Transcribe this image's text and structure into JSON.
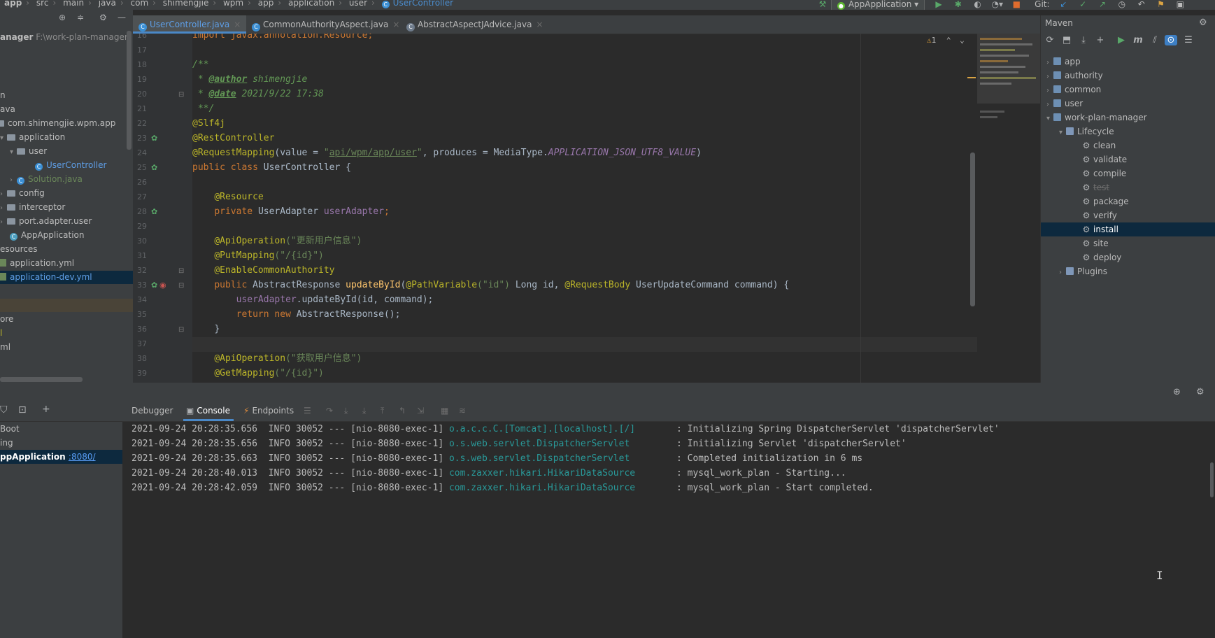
{
  "breadcrumb": [
    "app",
    "src",
    "main",
    "java",
    "com",
    "shimengjie",
    "wpm",
    "app",
    "application",
    "user",
    "UserController"
  ],
  "run_config": "AppApplication",
  "vcs_label": "Git:",
  "project": {
    "root_name": "anager",
    "root_path": "F:\\work-plan-manager",
    "rows": [
      {
        "label": "n"
      },
      {
        "label": "ava"
      },
      {
        "label": "com.shimengjie.wpm.app"
      },
      {
        "label": "application"
      },
      {
        "label": "user"
      },
      {
        "label": "UserController"
      },
      {
        "label": "Solution.java"
      },
      {
        "label": "config"
      },
      {
        "label": "interceptor"
      },
      {
        "label": "port.adapter.user"
      },
      {
        "label": "AppApplication"
      },
      {
        "label": "esources"
      },
      {
        "label": "application.yml"
      },
      {
        "label": "application-dev.yml"
      },
      {
        "label": ""
      },
      {
        "label": "ore"
      },
      {
        "label": "l"
      },
      {
        "label": "ml"
      }
    ]
  },
  "tabs": [
    {
      "label": "UserController.java"
    },
    {
      "label": "CommonAuthorityAspect.java"
    },
    {
      "label": "AbstractAspectJAdvice.java"
    }
  ],
  "editor": {
    "warnings": "1",
    "line_numbers": [
      "16",
      "17",
      "18",
      "19",
      "20",
      "21",
      "22",
      "23",
      "24",
      "25",
      "26",
      "27",
      "28",
      "29",
      "30",
      "31",
      "32",
      "33",
      "34",
      "35",
      "36",
      "37",
      "38",
      "39"
    ],
    "code": {
      "l16": "import javax.annotation.Resource;",
      "l18": "/**",
      "l19_tag": "@author",
      "l19_val": " shimengjie",
      "l20_tag": "@date",
      "l20_val": " 2021/9/22 17:38",
      "l21": " **/",
      "l22": "@Slf4j",
      "l23": "@RestController",
      "l24_ann": "@RequestMapping",
      "l24_a": "(value = ",
      "l24_q1": "\"",
      "l24_path": "api/wpm/app/user",
      "l24_q2": "\"",
      "l24_b": ", produces = MediaType.",
      "l24_const": "APPLICATION_JSON_UTF8_VALUE",
      "l24_c": ")",
      "l25_kw": "public class ",
      "l25_name": "UserController {",
      "l27": "@Resource",
      "l28_kw": "private ",
      "l28_type": "UserAdapter ",
      "l28_field": "userAdapter",
      "l28_end": ";",
      "l30_ann": "@ApiOperation",
      "l30_str": "(\"更新用户信息\")",
      "l31_ann": "@PutMapping",
      "l31_str": "(\"/{id}\")",
      "l32": "@EnableCommonAuthority",
      "l33_kw": "public ",
      "l33_type": "AbstractResponse ",
      "l33_fn": "updateById",
      "l33_p1": "(",
      "l33_ann1": "@PathVariable",
      "l33_s1": "(\"id\")",
      "l33_p2": " Long id, ",
      "l33_ann2": "@RequestBody",
      "l33_p3": " UserUpdateCommand command) {",
      "l34_field": "userAdapter",
      "l34_rest": ".updateById(id, command);",
      "l35_kw": "return new ",
      "l35_rest": "AbstractResponse();",
      "l36": "}",
      "l38_ann": "@ApiOperation",
      "l38_str": "(\"获取用户信息\")",
      "l39_ann": "@GetMapping",
      "l39_str": "(\"/{id}\")"
    }
  },
  "maven": {
    "title": "Maven",
    "items": [
      {
        "label": "app"
      },
      {
        "label": "authority"
      },
      {
        "label": "common"
      },
      {
        "label": "user"
      },
      {
        "label": "work-plan-manager"
      },
      {
        "label": "Lifecycle"
      },
      {
        "label": "clean"
      },
      {
        "label": "validate"
      },
      {
        "label": "compile"
      },
      {
        "label": "test"
      },
      {
        "label": "package"
      },
      {
        "label": "verify"
      },
      {
        "label": "install"
      },
      {
        "label": "site"
      },
      {
        "label": "deploy"
      },
      {
        "label": "Plugins"
      }
    ]
  },
  "debug": {
    "tabs": {
      "debugger": "Debugger",
      "console": "Console",
      "endpoints": "Endpoints"
    },
    "left_rows": [
      {
        "label": "Boot"
      },
      {
        "label": "ing"
      },
      {
        "label": "ppApplication",
        "port": ":8080/"
      }
    ]
  },
  "console": {
    "lines": [
      {
        "ts": "2021-09-24 20:28:35.656",
        "level": "INFO",
        "pid": "30052",
        "thread": "--- [nio-8080-exec-1]",
        "src": "o.a.c.c.C.[Tomcat].[localhost].[/]",
        "msg": ": Initializing Spring DispatcherServlet 'dispatcherServlet'"
      },
      {
        "ts": "2021-09-24 20:28:35.656",
        "level": "INFO",
        "pid": "30052",
        "thread": "--- [nio-8080-exec-1]",
        "src": "o.s.web.servlet.DispatcherServlet",
        "msg": ": Initializing Servlet 'dispatcherServlet'"
      },
      {
        "ts": "2021-09-24 20:28:35.663",
        "level": "INFO",
        "pid": "30052",
        "thread": "--- [nio-8080-exec-1]",
        "src": "o.s.web.servlet.DispatcherServlet",
        "msg": ": Completed initialization in 6 ms"
      },
      {
        "ts": "2021-09-24 20:28:40.013",
        "level": "INFO",
        "pid": "30052",
        "thread": "--- [nio-8080-exec-1]",
        "src": "com.zaxxer.hikari.HikariDataSource",
        "msg": ": mysql_work_plan - Starting..."
      },
      {
        "ts": "2021-09-24 20:28:42.059",
        "level": "INFO",
        "pid": "30052",
        "thread": "--- [nio-8080-exec-1]",
        "src": "com.zaxxer.hikari.HikariDataSource",
        "msg": ": mysql_work_plan - Start completed."
      }
    ]
  }
}
